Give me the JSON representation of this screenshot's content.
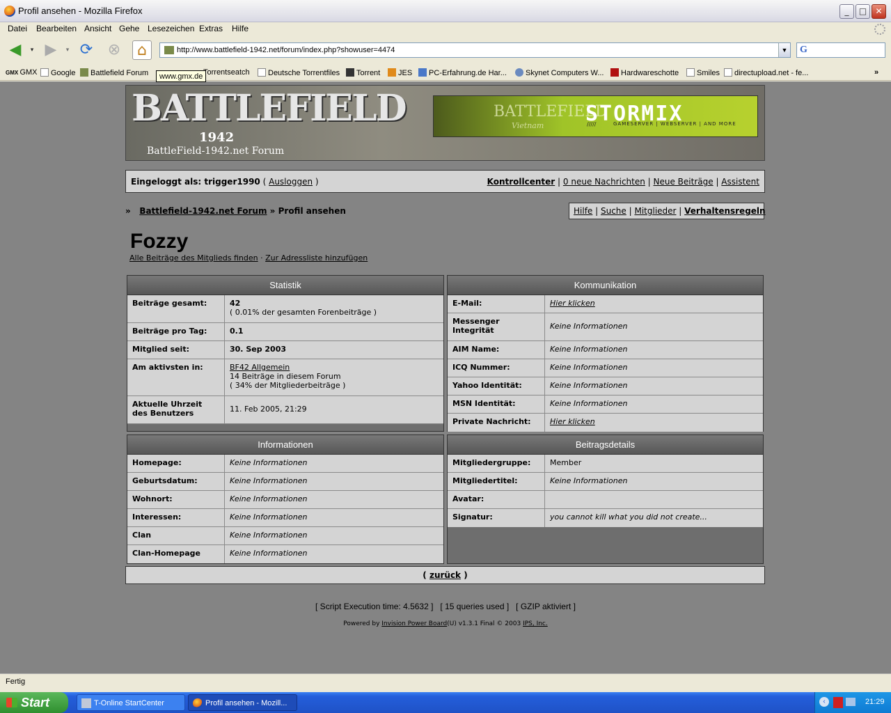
{
  "window": {
    "title": "Profil ansehen - Mozilla Firefox"
  },
  "menu": [
    "Datei",
    "Bearbeiten",
    "Ansicht",
    "Gehe",
    "Lesezeichen",
    "Extras",
    "Hilfe"
  ],
  "address": {
    "url": "http://www.battlefield-1942.net/forum/index.php?showuser=4474"
  },
  "bookmarks": [
    "GMX",
    "Google",
    "Battlefield Forum",
    "Torrentseatch",
    "Deutsche Torrentfiles",
    "Torrent",
    "JES",
    "PC-Erfahrung.de Har...",
    "Skynet Computers W...",
    "Hardwareschotte",
    "Smiles",
    "directupload.net - fe..."
  ],
  "tooltip": "www.gmx.de",
  "banner": {
    "logo": "BATTLEFIELD",
    "year": "1942",
    "forum": "BattleField-1942.net Forum",
    "ad_left": "BATTLEFIELD",
    "ad_left_sub": "Vietnam",
    "ad_right": "STORMIX",
    "ad_tagline": "GAMESERVER | WEBSERVER | AND MORE",
    "ad_slashes": "/////"
  },
  "userbar": {
    "logged_in": "Eingeloggt als: trigger1990",
    "open": "(",
    "logout": "Ausloggen",
    "close": ")",
    "links": [
      "Kontrollcenter",
      "0 neue Nachrichten",
      "Neue Beiträge",
      "Assistent"
    ]
  },
  "breadcrumb": {
    "arrow": "»",
    "forum": "Battlefield-1942.net Forum",
    "current": "» Profil ansehen"
  },
  "rightnav": [
    "Hilfe",
    "Suche",
    "Mitglieder",
    "Verhaltensregeln"
  ],
  "profile": {
    "name": "Fozzy",
    "link1": "Alle Beiträge des Mitglieds finden",
    "sep": "·",
    "link2": "Zur Adressliste hinzufügen"
  },
  "statistik": {
    "title": "Statistik",
    "posts_label": "Beiträge gesamt:",
    "posts_value": "42",
    "posts_sub": "( 0.01% der gesamten Forenbeiträge )",
    "perday_label": "Beiträge pro Tag:",
    "perday_value": "0.1",
    "since_label": "Mitglied seit:",
    "since_value": "30. Sep 2003",
    "active_label": "Am aktivsten in:",
    "active_forum": "BF42 Allgemein",
    "active_count": "14 Beiträge in diesem Forum",
    "active_pct": "( 34% der Mitgliederbeiträge )",
    "time_label": "Aktuelle Uhrzeit des Benutzers",
    "time_value": "11. Feb 2005, 21:29"
  },
  "kommunikation": {
    "title": "Kommunikation",
    "rows": [
      {
        "label": "E-Mail:",
        "value": "Hier klicken"
      },
      {
        "label": "Messenger Integrität",
        "value": "Keine Informationen"
      },
      {
        "label": "AIM Name:",
        "value": "Keine Informationen"
      },
      {
        "label": "ICQ Nummer:",
        "value": "Keine Informationen"
      },
      {
        "label": "Yahoo Identität:",
        "value": "Keine Informationen"
      },
      {
        "label": "MSN Identität:",
        "value": "Keine Informationen"
      },
      {
        "label": "Private Nachricht:",
        "value": "Hier klicken"
      }
    ]
  },
  "informationen": {
    "title": "Informationen",
    "rows": [
      {
        "label": "Homepage:",
        "value": "Keine Informationen"
      },
      {
        "label": "Geburtsdatum:",
        "value": "Keine Informationen"
      },
      {
        "label": "Wohnort:",
        "value": "Keine Informationen"
      },
      {
        "label": "Interessen:",
        "value": "Keine Informationen"
      },
      {
        "label": "Clan",
        "value": "Keine Informationen"
      },
      {
        "label": "Clan-Homepage",
        "value": "Keine Informationen"
      }
    ]
  },
  "beitragsdetails": {
    "title": "Beitragsdetails",
    "rows": [
      {
        "label": "Mitgliedergruppe:",
        "value": "Member"
      },
      {
        "label": "Mitgliedertitel:",
        "value": "Keine Informationen"
      },
      {
        "label": "Avatar:",
        "value": ""
      },
      {
        "label": "Signatur:",
        "value": "you cannot kill what you did not create..."
      }
    ]
  },
  "back": {
    "open": "(",
    "label": "zurück",
    "close": ")"
  },
  "footer": {
    "stats": "[ Script Execution time: 4.5632 ]   [ 15 queries used ]   [ GZIP aktiviert ]",
    "powered_pre": "Powered by",
    "ipb": "Invision Power Board",
    "powered_mid": "(U) v1.3.1 Final © 2003",
    "ips": "IPS, Inc."
  },
  "status": "Fertig",
  "taskbar": {
    "start": "Start",
    "tasks": [
      "T-Online StartCenter",
      "Profil ansehen - Mozill..."
    ],
    "clock": "21:29"
  },
  "colors": {
    "page_bg": "#848484",
    "panel_bg": "#d4d4d4",
    "header_bg": "#5c5c5c",
    "taskbar": "#245edb"
  }
}
